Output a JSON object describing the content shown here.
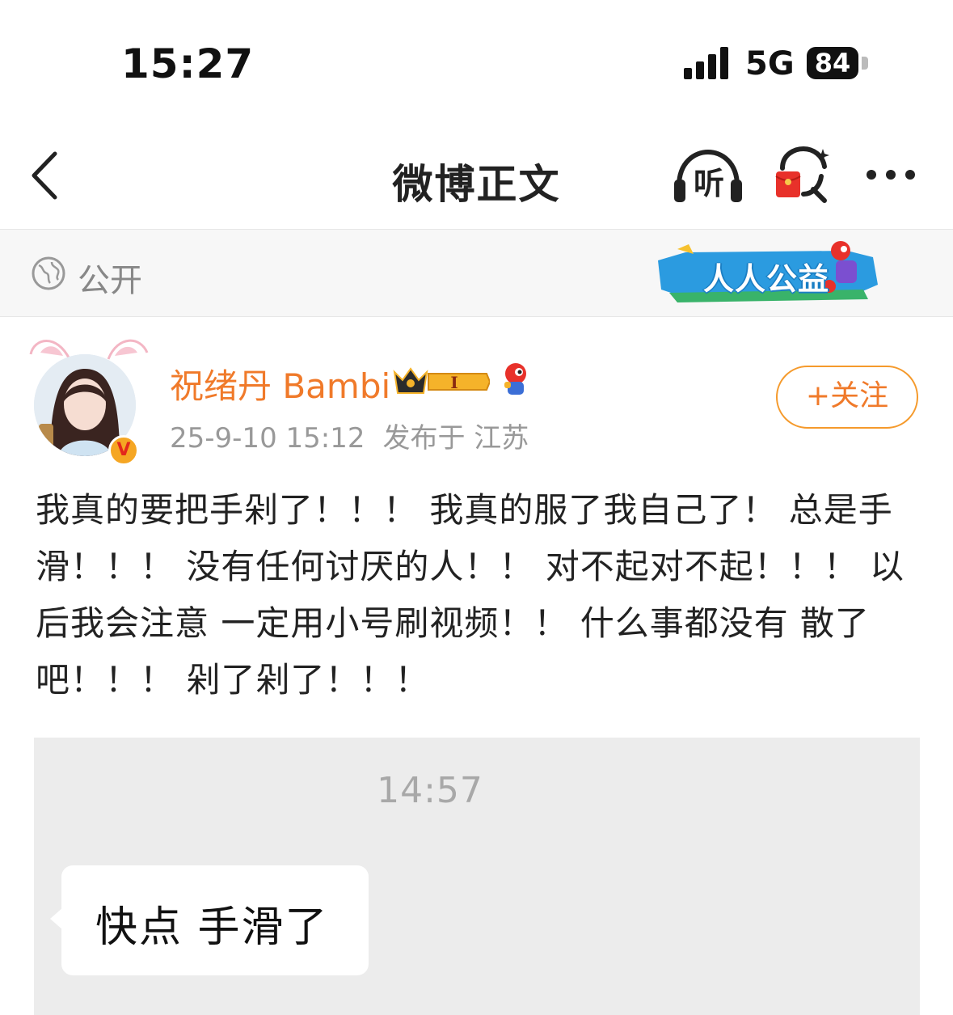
{
  "status_bar": {
    "time": "15:27",
    "network": "5G",
    "battery": "84"
  },
  "nav": {
    "title": "微博正文",
    "listen_label": "听"
  },
  "visibility": {
    "label": "公开",
    "banner_text": "人人公益"
  },
  "post": {
    "author": "祝绪丹 Bambi",
    "vip_level": "I",
    "verified_mark": "V",
    "date": "25-9-10 15:12",
    "location": "发布于 江苏",
    "follow_label": "+关注",
    "text": "我真的要把手剁了！！！ 我真的服了我自己了！ 总是手滑！！！ 没有任何讨厌的人！！ 对不起对不起！！！ 以后我会注意 一定用小号刷视频！！ 什么事都没有 散了吧！！！ 剁了剁了！！！"
  },
  "image": {
    "chat_time": "14:57",
    "chat_message": "快点 手滑了"
  },
  "colors": {
    "accent_orange": "#f07a2a",
    "follow_border": "#f59a2c",
    "meta_gray": "#999999",
    "image_bg": "#ececec"
  }
}
